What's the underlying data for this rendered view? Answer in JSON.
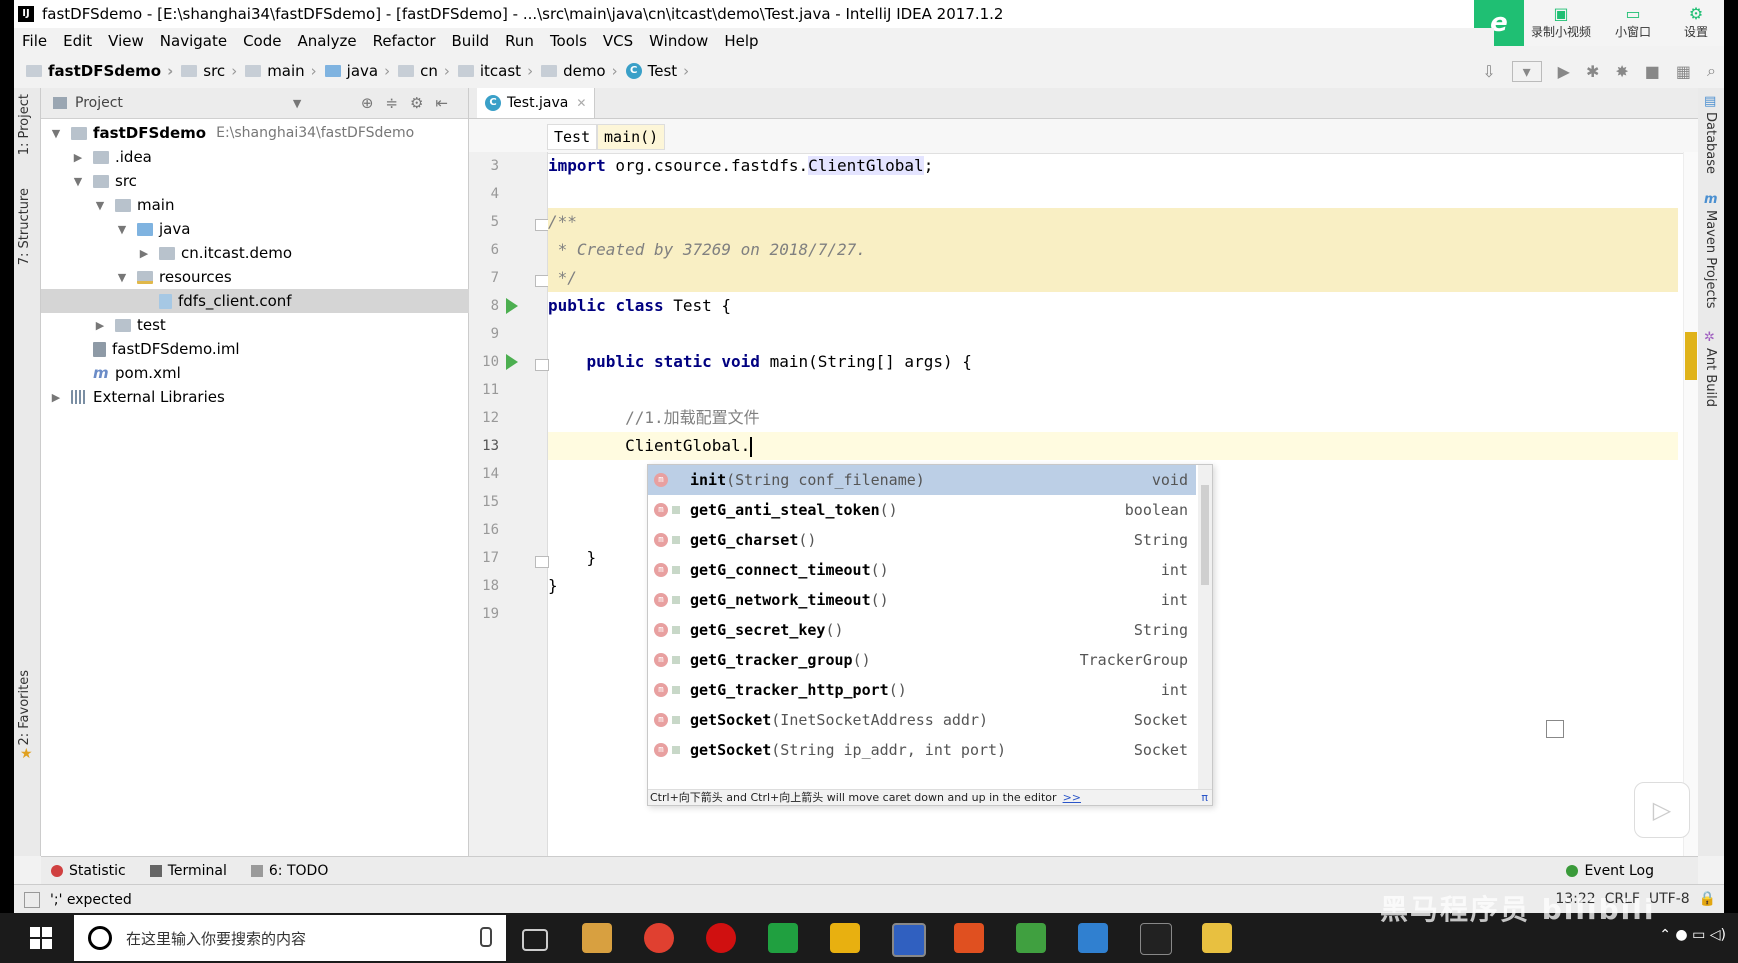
{
  "window": {
    "title": "fastDFSdemo - [E:\\shanghai34\\fastDFSdemo] - [fastDFSdemo] - ...\\src\\main\\java\\cn\\itcast\\demo\\Test.java - IntelliJ IDEA 2017.1.2",
    "app_icon": "IJ"
  },
  "recorder": {
    "e_label": "e",
    "record_label": "录制小视频",
    "mini_label": "小窗口",
    "settings_label": "设置"
  },
  "menu": [
    "File",
    "Edit",
    "View",
    "Navigate",
    "Code",
    "Analyze",
    "Refactor",
    "Build",
    "Run",
    "Tools",
    "VCS",
    "Window",
    "Help"
  ],
  "breadcrumb": [
    "fastDFSdemo",
    "src",
    "main",
    "java",
    "cn",
    "itcast",
    "demo",
    "Test"
  ],
  "left_tabs": {
    "project": "1: Project",
    "structure": "7: Structure",
    "favorites": "2: Favorites"
  },
  "right_tabs": {
    "database": "Database",
    "maven": "Maven Projects",
    "ant": "Ant Build"
  },
  "project_panel": {
    "header": "Project",
    "tree": [
      {
        "label": "fastDFSdemo",
        "path": "E:\\shanghai34\\fastDFSdemo",
        "depth": 0,
        "expanded": true
      },
      {
        "label": ".idea",
        "depth": 1,
        "expanded": false
      },
      {
        "label": "src",
        "depth": 1,
        "expanded": true
      },
      {
        "label": "main",
        "depth": 2,
        "expanded": true
      },
      {
        "label": "java",
        "depth": 3,
        "expanded": true
      },
      {
        "label": "cn.itcast.demo",
        "depth": 4,
        "expanded": false
      },
      {
        "label": "resources",
        "depth": 3,
        "expanded": true
      },
      {
        "label": "fdfs_client.conf",
        "depth": 4,
        "selected": true
      },
      {
        "label": "test",
        "depth": 2,
        "expanded": false
      },
      {
        "label": "fastDFSdemo.iml",
        "depth": 1
      },
      {
        "label": "pom.xml",
        "depth": 1
      },
      {
        "label": "External Libraries",
        "depth": 0,
        "expanded": false
      }
    ]
  },
  "editor": {
    "tab": "Test.java",
    "tab_icon": "C",
    "crumbs": [
      "Test",
      "main()"
    ],
    "lines": [
      {
        "n": "3",
        "text": "import org.csource.fastdfs.ClientGlobal;"
      },
      {
        "n": "4",
        "text": ""
      },
      {
        "n": "5",
        "text": "/**"
      },
      {
        "n": "6",
        "text": " * Created by 37269 on 2018/7/27."
      },
      {
        "n": "7",
        "text": " */"
      },
      {
        "n": "8",
        "text": "public class Test {"
      },
      {
        "n": "9",
        "text": ""
      },
      {
        "n": "10",
        "text": "    public static void main(String[] args) {"
      },
      {
        "n": "11",
        "text": ""
      },
      {
        "n": "12",
        "text": "        //1.加载配置文件"
      },
      {
        "n": "13",
        "text": "        ClientGlobal."
      },
      {
        "n": "14",
        "text": ""
      },
      {
        "n": "15",
        "text": ""
      },
      {
        "n": "16",
        "text": ""
      },
      {
        "n": "17",
        "text": "    }"
      },
      {
        "n": "18",
        "text": "}"
      },
      {
        "n": "19",
        "text": ""
      }
    ]
  },
  "completion": {
    "items": [
      {
        "name": "init",
        "params": "(String conf_filename)",
        "type": "void"
      },
      {
        "name": "getG_anti_steal_token",
        "params": "()",
        "type": "boolean"
      },
      {
        "name": "getG_charset",
        "params": "()",
        "type": "String"
      },
      {
        "name": "getG_connect_timeout",
        "params": "()",
        "type": "int"
      },
      {
        "name": "getG_network_timeout",
        "params": "()",
        "type": "int"
      },
      {
        "name": "getG_secret_key",
        "params": "()",
        "type": "String"
      },
      {
        "name": "getG_tracker_group",
        "params": "()",
        "type": "TrackerGroup"
      },
      {
        "name": "getG_tracker_http_port",
        "params": "()",
        "type": "int"
      },
      {
        "name": "getSocket",
        "params": "(InetSocketAddress addr)",
        "type": "Socket"
      },
      {
        "name": "getSocket",
        "params": "(String ip_addr, int port)",
        "type": "Socket"
      }
    ],
    "footer": "Ctrl+向下箭头 and Ctrl+向上箭头 will move caret down and up in the editor",
    "footer_link": ">>",
    "pi": "π"
  },
  "bottom_tools": [
    "Statistic",
    "Terminal",
    "6: TODO"
  ],
  "event_log": "Event Log",
  "status": {
    "message": "';' expected",
    "position": "13:22",
    "line_sep": "CRLF",
    "encoding": "UTF-8"
  },
  "taskbar": {
    "search_placeholder": "在这里输入你要搜索的内容"
  },
  "watermark": "黑马程序员 bilibili"
}
